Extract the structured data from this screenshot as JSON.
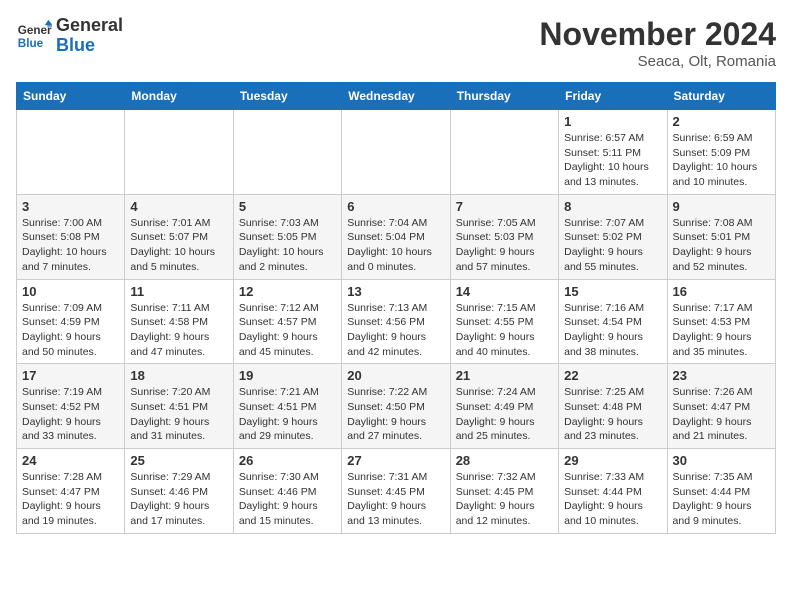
{
  "header": {
    "logo": {
      "line1": "General",
      "line2": "Blue"
    },
    "title": "November 2024",
    "location": "Seaca, Olt, Romania"
  },
  "weekdays": [
    "Sunday",
    "Monday",
    "Tuesday",
    "Wednesday",
    "Thursday",
    "Friday",
    "Saturday"
  ],
  "weeks": [
    [
      {
        "day": "",
        "info": ""
      },
      {
        "day": "",
        "info": ""
      },
      {
        "day": "",
        "info": ""
      },
      {
        "day": "",
        "info": ""
      },
      {
        "day": "",
        "info": ""
      },
      {
        "day": "1",
        "info": "Sunrise: 6:57 AM\nSunset: 5:11 PM\nDaylight: 10 hours and 13 minutes."
      },
      {
        "day": "2",
        "info": "Sunrise: 6:59 AM\nSunset: 5:09 PM\nDaylight: 10 hours and 10 minutes."
      }
    ],
    [
      {
        "day": "3",
        "info": "Sunrise: 7:00 AM\nSunset: 5:08 PM\nDaylight: 10 hours and 7 minutes."
      },
      {
        "day": "4",
        "info": "Sunrise: 7:01 AM\nSunset: 5:07 PM\nDaylight: 10 hours and 5 minutes."
      },
      {
        "day": "5",
        "info": "Sunrise: 7:03 AM\nSunset: 5:05 PM\nDaylight: 10 hours and 2 minutes."
      },
      {
        "day": "6",
        "info": "Sunrise: 7:04 AM\nSunset: 5:04 PM\nDaylight: 10 hours and 0 minutes."
      },
      {
        "day": "7",
        "info": "Sunrise: 7:05 AM\nSunset: 5:03 PM\nDaylight: 9 hours and 57 minutes."
      },
      {
        "day": "8",
        "info": "Sunrise: 7:07 AM\nSunset: 5:02 PM\nDaylight: 9 hours and 55 minutes."
      },
      {
        "day": "9",
        "info": "Sunrise: 7:08 AM\nSunset: 5:01 PM\nDaylight: 9 hours and 52 minutes."
      }
    ],
    [
      {
        "day": "10",
        "info": "Sunrise: 7:09 AM\nSunset: 4:59 PM\nDaylight: 9 hours and 50 minutes."
      },
      {
        "day": "11",
        "info": "Sunrise: 7:11 AM\nSunset: 4:58 PM\nDaylight: 9 hours and 47 minutes."
      },
      {
        "day": "12",
        "info": "Sunrise: 7:12 AM\nSunset: 4:57 PM\nDaylight: 9 hours and 45 minutes."
      },
      {
        "day": "13",
        "info": "Sunrise: 7:13 AM\nSunset: 4:56 PM\nDaylight: 9 hours and 42 minutes."
      },
      {
        "day": "14",
        "info": "Sunrise: 7:15 AM\nSunset: 4:55 PM\nDaylight: 9 hours and 40 minutes."
      },
      {
        "day": "15",
        "info": "Sunrise: 7:16 AM\nSunset: 4:54 PM\nDaylight: 9 hours and 38 minutes."
      },
      {
        "day": "16",
        "info": "Sunrise: 7:17 AM\nSunset: 4:53 PM\nDaylight: 9 hours and 35 minutes."
      }
    ],
    [
      {
        "day": "17",
        "info": "Sunrise: 7:19 AM\nSunset: 4:52 PM\nDaylight: 9 hours and 33 minutes."
      },
      {
        "day": "18",
        "info": "Sunrise: 7:20 AM\nSunset: 4:51 PM\nDaylight: 9 hours and 31 minutes."
      },
      {
        "day": "19",
        "info": "Sunrise: 7:21 AM\nSunset: 4:51 PM\nDaylight: 9 hours and 29 minutes."
      },
      {
        "day": "20",
        "info": "Sunrise: 7:22 AM\nSunset: 4:50 PM\nDaylight: 9 hours and 27 minutes."
      },
      {
        "day": "21",
        "info": "Sunrise: 7:24 AM\nSunset: 4:49 PM\nDaylight: 9 hours and 25 minutes."
      },
      {
        "day": "22",
        "info": "Sunrise: 7:25 AM\nSunset: 4:48 PM\nDaylight: 9 hours and 23 minutes."
      },
      {
        "day": "23",
        "info": "Sunrise: 7:26 AM\nSunset: 4:47 PM\nDaylight: 9 hours and 21 minutes."
      }
    ],
    [
      {
        "day": "24",
        "info": "Sunrise: 7:28 AM\nSunset: 4:47 PM\nDaylight: 9 hours and 19 minutes."
      },
      {
        "day": "25",
        "info": "Sunrise: 7:29 AM\nSunset: 4:46 PM\nDaylight: 9 hours and 17 minutes."
      },
      {
        "day": "26",
        "info": "Sunrise: 7:30 AM\nSunset: 4:46 PM\nDaylight: 9 hours and 15 minutes."
      },
      {
        "day": "27",
        "info": "Sunrise: 7:31 AM\nSunset: 4:45 PM\nDaylight: 9 hours and 13 minutes."
      },
      {
        "day": "28",
        "info": "Sunrise: 7:32 AM\nSunset: 4:45 PM\nDaylight: 9 hours and 12 minutes."
      },
      {
        "day": "29",
        "info": "Sunrise: 7:33 AM\nSunset: 4:44 PM\nDaylight: 9 hours and 10 minutes."
      },
      {
        "day": "30",
        "info": "Sunrise: 7:35 AM\nSunset: 4:44 PM\nDaylight: 9 hours and 9 minutes."
      }
    ]
  ]
}
